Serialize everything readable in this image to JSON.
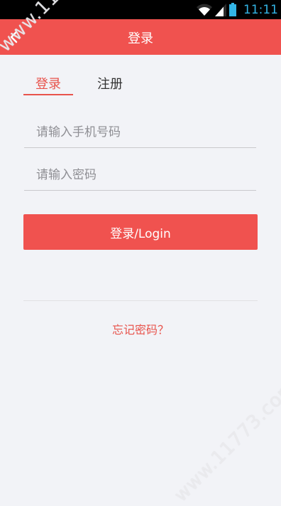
{
  "status_bar": {
    "time": "11:11",
    "icons": [
      "wifi-icon",
      "signal-icon",
      "battery-icon"
    ]
  },
  "title_bar": {
    "title": "登录",
    "back_icon": "chevron-left-icon"
  },
  "tabs": [
    {
      "label": "登录",
      "active": true
    },
    {
      "label": "注册",
      "active": false
    }
  ],
  "form": {
    "phone_placeholder": "请输入手机号码",
    "password_placeholder": "请输入密码",
    "login_label": "登录/Login",
    "forgot_label": "忘记密码？"
  },
  "watermark": {
    "text": "www.11773.com"
  },
  "colors": {
    "accent": "#f0524f",
    "background": "#f2f3f7",
    "status_bar": "#000000",
    "status_accent": "#33b5e5"
  }
}
